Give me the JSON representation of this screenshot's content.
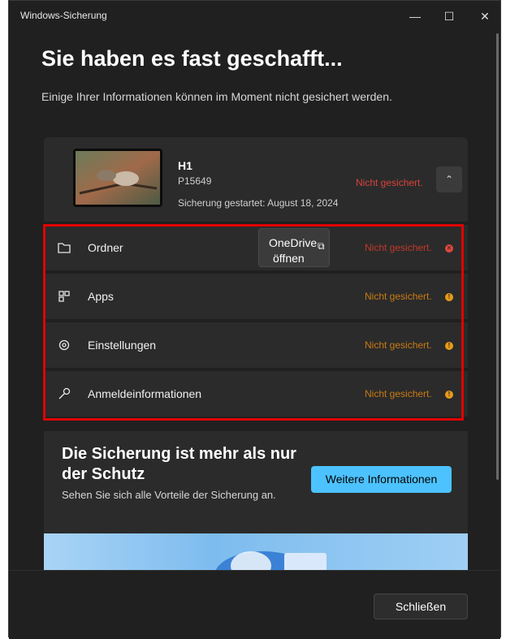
{
  "window": {
    "title": "Windows-Sicherung"
  },
  "header": {
    "heading": "Sie haben es fast geschafft...",
    "subtitle": "Einige Ihrer Informationen können im Moment nicht gesichert werden."
  },
  "device": {
    "name": "H1",
    "id": "P15649",
    "started": "Sicherung gestartet: August 18, 2024",
    "status": "Nicht gesichert."
  },
  "items": [
    {
      "label": "Ordner",
      "status": "Nicht gesichert.",
      "icon": "folder-icon",
      "severity": "error"
    },
    {
      "label": "Apps",
      "status": "Nicht gesichert.",
      "icon": "apps-icon",
      "severity": "warning"
    },
    {
      "label": "Einstellungen",
      "status": "Nicht gesichert.",
      "icon": "gear-icon",
      "severity": "warning"
    },
    {
      "label": "Anmeldeinformationen",
      "status": "Nicht gesichert.",
      "icon": "key-icon",
      "severity": "warning"
    }
  ],
  "onedrive_button": {
    "line1": "OneDrive",
    "line2": "öffnen"
  },
  "promo": {
    "title": "Die Sicherung ist mehr als nur der Schutz",
    "text": "Sehen Sie sich alle Vorteile der Sicherung an.",
    "button": "Weitere Informationen"
  },
  "footer": {
    "close_label": "Schließen"
  },
  "colors": {
    "background": "#202020",
    "card": "#2b2b2b",
    "accent": "#4cc2ff",
    "error": "#e0463c",
    "warning": "#e79a16",
    "highlight": "#e10000"
  }
}
